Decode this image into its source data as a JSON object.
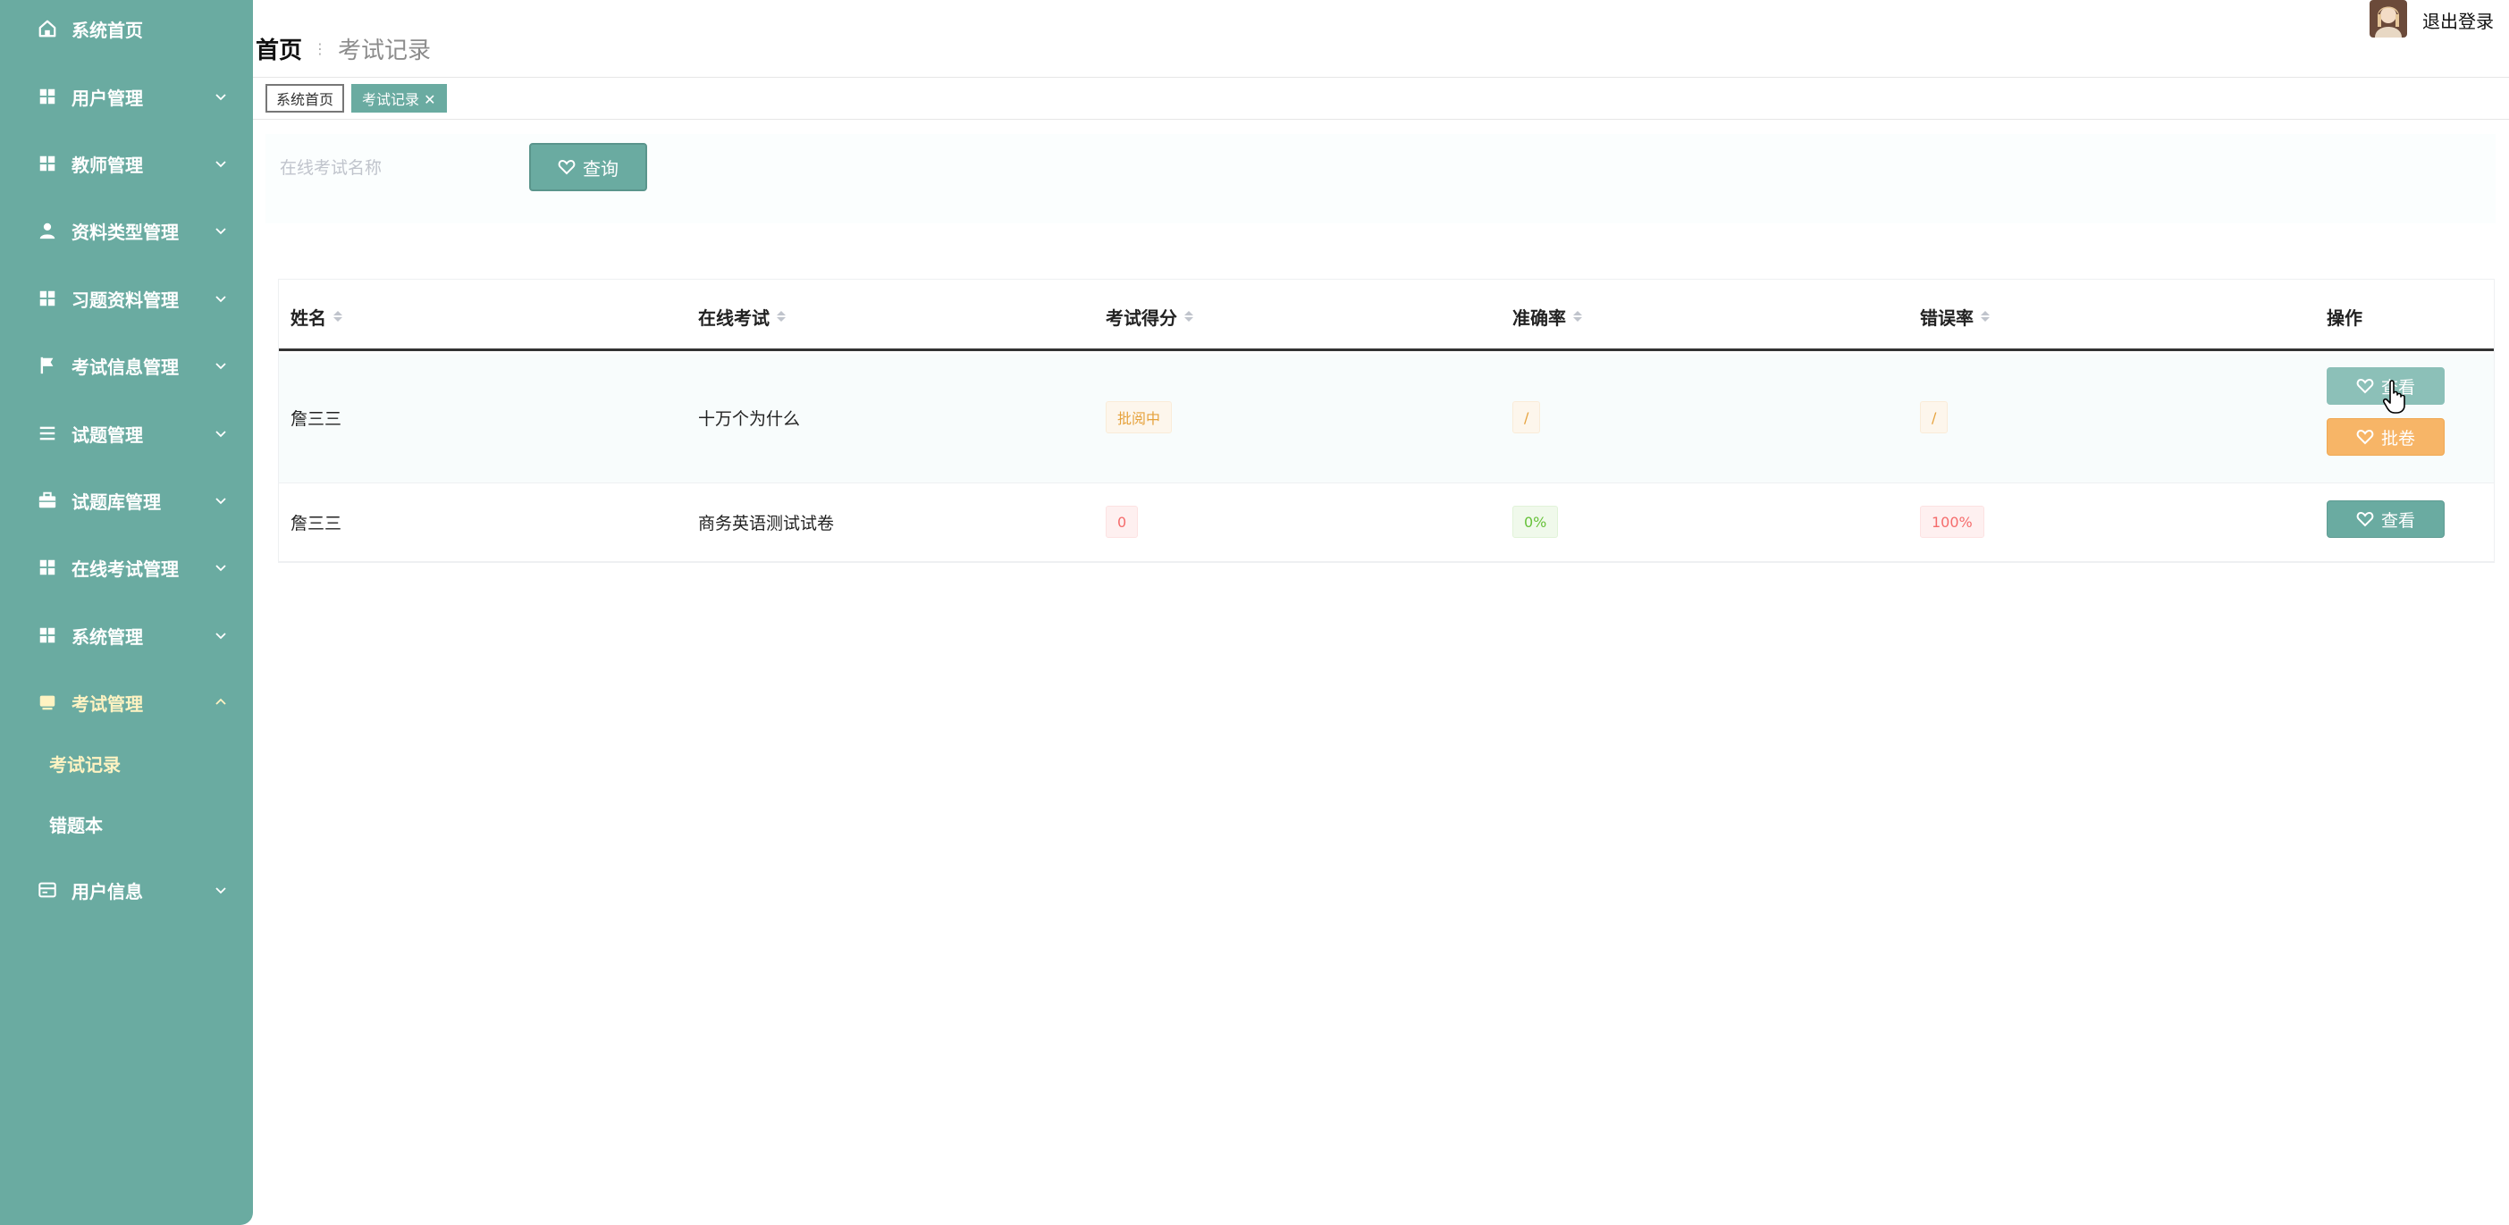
{
  "sidebar": {
    "items": [
      {
        "label": "系统首页",
        "icon": "home-icon"
      },
      {
        "label": "用户管理",
        "icon": "grid-icon"
      },
      {
        "label": "教师管理",
        "icon": "grid-icon"
      },
      {
        "label": "资料类型管理",
        "icon": "user-icon"
      },
      {
        "label": "习题资料管理",
        "icon": "grid-icon"
      },
      {
        "label": "考试信息管理",
        "icon": "flag-icon"
      },
      {
        "label": "试题管理",
        "icon": "list-icon"
      },
      {
        "label": "试题库管理",
        "icon": "briefcase-icon"
      },
      {
        "label": "在线考试管理",
        "icon": "grid-icon"
      },
      {
        "label": "系统管理",
        "icon": "grid-icon"
      },
      {
        "label": "考试管理",
        "icon": "folder-icon"
      },
      {
        "label": "用户信息",
        "icon": "card-icon"
      }
    ],
    "sub_items": [
      {
        "label": "考试记录"
      },
      {
        "label": "错题本"
      }
    ]
  },
  "header": {
    "breadcrumb_home": "首页",
    "breadcrumb_current": "考试记录",
    "logout_label": "退出登录"
  },
  "tabs": [
    {
      "label": "系统首页"
    },
    {
      "label": "考试记录 ✕"
    }
  ],
  "search": {
    "placeholder": "在线考试名称",
    "value": "",
    "button_label": "查询"
  },
  "table": {
    "columns": [
      "姓名",
      "在线考试",
      "考试得分",
      "准确率",
      "错误率",
      "操作"
    ],
    "rows": [
      {
        "name": "詹三三",
        "exam": "十万个为什么",
        "score": "批阅中",
        "accuracy": "/",
        "error_rate": "/",
        "actions": [
          "查看",
          "批卷"
        ]
      },
      {
        "name": "詹三三",
        "exam": "商务英语测试试卷",
        "score": "0",
        "accuracy": "0%",
        "error_rate": "100%",
        "actions": [
          "查看"
        ]
      }
    ]
  },
  "colors": {
    "primary": "#6aaba1",
    "warning_button": "#f7b567",
    "active_menu_text": "#fff3c2"
  }
}
